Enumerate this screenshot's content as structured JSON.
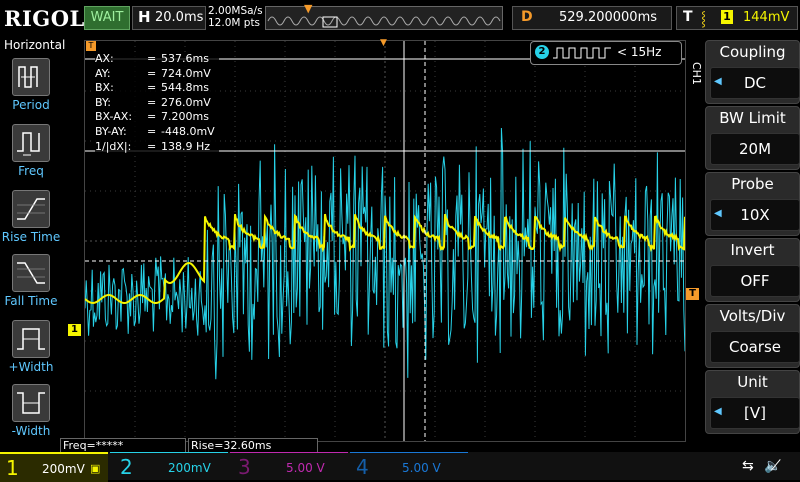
{
  "brand": "RIGOL",
  "run_state": "WAIT",
  "timebase": {
    "label": "H",
    "value": "20.0ms"
  },
  "sample_rate": "2.00MSa/s",
  "memory_depth": "12.0M pts",
  "trigger_position": {
    "label": "D",
    "value": "529.200000ms"
  },
  "trigger": {
    "label": "T",
    "source": "1",
    "level": "144mV",
    "edge_icon": "rising-edge-icon"
  },
  "left_menu": {
    "title": "Horizontal",
    "items": [
      {
        "label": "Period",
        "icon": "period-icon"
      },
      {
        "label": "Freq",
        "icon": "freq-icon"
      },
      {
        "label": "Rise Time",
        "icon": "rise-time-icon"
      },
      {
        "label": "Fall Time",
        "icon": "fall-time-icon"
      },
      {
        "label": "+Width",
        "icon": "positive-width-icon"
      },
      {
        "label": "-Width",
        "icon": "negative-width-icon"
      }
    ]
  },
  "right_menu": {
    "channel": "CH1",
    "items": [
      {
        "label": "Coupling",
        "value": "DC",
        "has_arrow": true
      },
      {
        "label": "BW Limit",
        "value": "20M",
        "has_arrow": false
      },
      {
        "label": "Probe",
        "value": "10X",
        "has_arrow": true
      },
      {
        "label": "Invert",
        "value": "OFF",
        "has_arrow": false
      },
      {
        "label": "Volts/Div",
        "value": "Coarse",
        "has_arrow": false
      },
      {
        "label": "Unit",
        "value": "[V]",
        "has_arrow": true
      }
    ]
  },
  "cursor_readout": [
    {
      "key": "AX:",
      "value": "537.6ms"
    },
    {
      "key": "AY:",
      "value": "724.0mV"
    },
    {
      "key": "BX:",
      "value": "544.8ms"
    },
    {
      "key": "BY:",
      "value": "276.0mV"
    },
    {
      "key": "BX-AX:",
      "value": "7.200ms"
    },
    {
      "key": "BY-AY:",
      "value": "-448.0mV"
    },
    {
      "key": "1/|dX|:",
      "value": "138.9 Hz"
    }
  ],
  "ch2_frequency": {
    "channel": "2",
    "value": "< 15Hz"
  },
  "measurements": [
    "Freq=*****",
    "Rise=32.60ms"
  ],
  "channels": [
    {
      "num": "1",
      "scale": "200mV",
      "color": "#f5f500",
      "active": true
    },
    {
      "num": "2",
      "scale": "200mV",
      "color": "#27d2e8",
      "active": false
    },
    {
      "num": "3",
      "scale": "5.00 V",
      "color": "#c02ab0",
      "active": false
    },
    {
      "num": "4",
      "scale": "5.00 V",
      "color": "#1a78d6",
      "active": false
    }
  ],
  "markers": {
    "ch1_ground": "1",
    "trigger_level": "T"
  },
  "colors": {
    "ch1": "#f5f500",
    "ch2": "#27d2e8",
    "accent": "#f59a2a",
    "menu_label": "#5fc8ff"
  }
}
